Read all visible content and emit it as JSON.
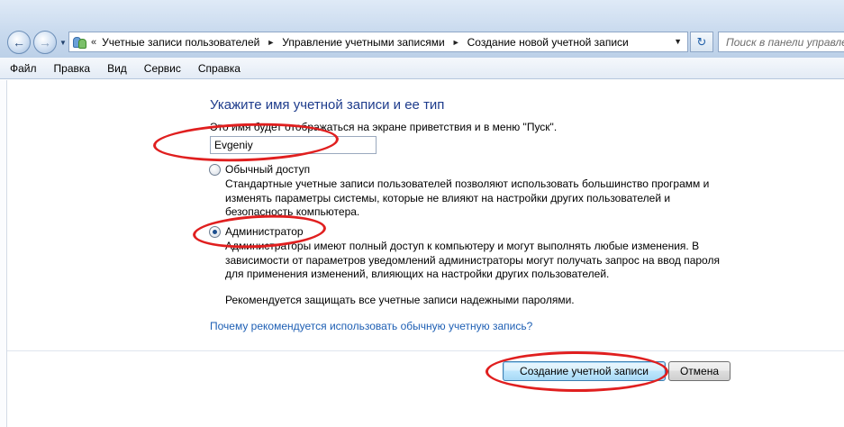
{
  "addressbar": {
    "breadcrumb_prefix": "«",
    "breadcrumbs": [
      "Учетные записи пользователей",
      "Управление учетными записями",
      "Создание новой учетной записи"
    ],
    "search_placeholder": "Поиск в панели управле"
  },
  "menu": [
    "Файл",
    "Правка",
    "Вид",
    "Сервис",
    "Справка"
  ],
  "page": {
    "heading": "Укажите имя учетной записи и ее тип",
    "hint": "Это имя будет отображаться на экране приветствия и в меню \"Пуск\".",
    "account_name_value": "Evgeniy",
    "options": [
      {
        "label": "Обычный доступ",
        "selected": false,
        "description": "Стандартные учетные записи пользователей позволяют использовать большинство программ и изменять параметры системы, которые не влияют на настройки других пользователей и безопасность компьютера."
      },
      {
        "label": "Администратор",
        "selected": true,
        "description": "Администраторы имеют полный доступ к компьютеру и могут выполнять любые изменения. В зависимости от параметров уведомлений администраторы могут получать запрос на ввод пароля для применения изменений, влияющих на настройки других пользователей."
      }
    ],
    "recommendation": "Рекомендуется защищать все учетные записи надежными паролями.",
    "help_link": "Почему рекомендуется использовать обычную учетную запись?"
  },
  "buttons": {
    "create": "Создание учетной записи",
    "cancel": "Отмена"
  },
  "colors": {
    "heading": "#1e3c8c",
    "link": "#1e5fb4",
    "annotation": "#e01f1f"
  },
  "icons": [
    "back-arrow-icon",
    "forward-arrow-icon",
    "users-icon",
    "refresh-icon",
    "search-icon"
  ]
}
